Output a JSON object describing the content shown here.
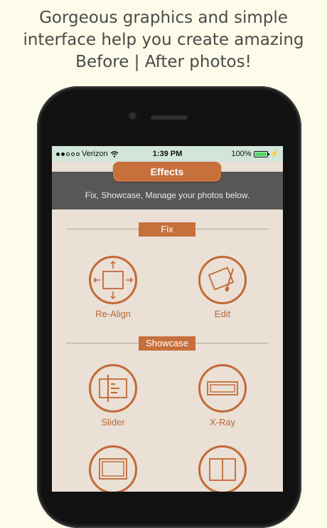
{
  "headline": {
    "line1": "Gorgeous graphics and simple",
    "line2": "interface help you create amazing",
    "line3": "Before | After photos!"
  },
  "status_bar": {
    "carrier": "Verizon",
    "time": "1:39 PM",
    "battery": "100%"
  },
  "header": {
    "title": "Effects",
    "subtitle": "Fix, Showcase, Manage your photos below."
  },
  "sections": {
    "fix": {
      "label": "Fix",
      "tools": [
        {
          "label": "Re-Align",
          "icon": "re-align-icon"
        },
        {
          "label": "Edit",
          "icon": "edit-icon"
        }
      ]
    },
    "showcase": {
      "label": "Showcase",
      "tools": [
        {
          "label": "Slider",
          "icon": "slider-icon"
        },
        {
          "label": "X-Ray",
          "icon": "x-ray-icon"
        }
      ]
    }
  },
  "colors": {
    "accent": "#c8703c",
    "screen_bg": "#eae0d5",
    "status_bar_bg": "#d2e5da",
    "info_bar_bg": "#575757",
    "page_bg": "#fdfbe9"
  }
}
